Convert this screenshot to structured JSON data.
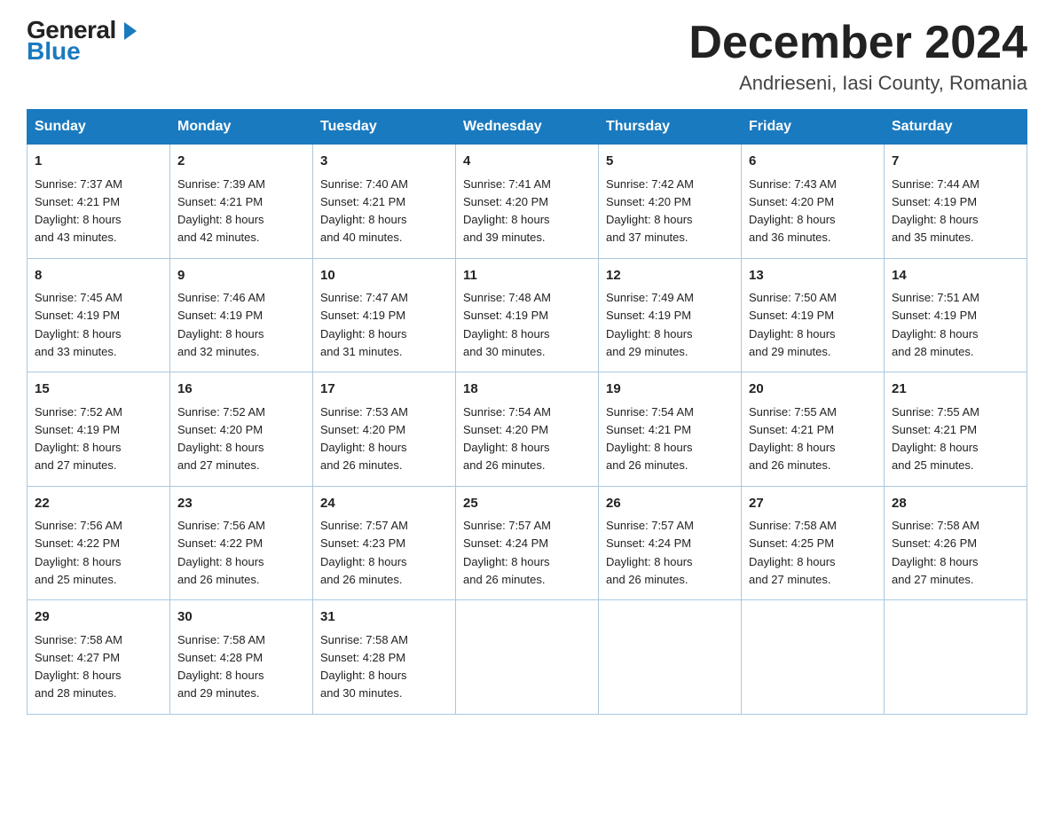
{
  "header": {
    "logo": {
      "general": "General",
      "blue": "Blue"
    },
    "month_title": "December 2024",
    "location": "Andrieseni, Iasi County, Romania"
  },
  "days_of_week": [
    "Sunday",
    "Monday",
    "Tuesday",
    "Wednesday",
    "Thursday",
    "Friday",
    "Saturday"
  ],
  "weeks": [
    [
      {
        "day": "1",
        "sunrise": "7:37 AM",
        "sunset": "4:21 PM",
        "daylight": "8 hours and 43 minutes."
      },
      {
        "day": "2",
        "sunrise": "7:39 AM",
        "sunset": "4:21 PM",
        "daylight": "8 hours and 42 minutes."
      },
      {
        "day": "3",
        "sunrise": "7:40 AM",
        "sunset": "4:21 PM",
        "daylight": "8 hours and 40 minutes."
      },
      {
        "day": "4",
        "sunrise": "7:41 AM",
        "sunset": "4:20 PM",
        "daylight": "8 hours and 39 minutes."
      },
      {
        "day": "5",
        "sunrise": "7:42 AM",
        "sunset": "4:20 PM",
        "daylight": "8 hours and 37 minutes."
      },
      {
        "day": "6",
        "sunrise": "7:43 AM",
        "sunset": "4:20 PM",
        "daylight": "8 hours and 36 minutes."
      },
      {
        "day": "7",
        "sunrise": "7:44 AM",
        "sunset": "4:19 PM",
        "daylight": "8 hours and 35 minutes."
      }
    ],
    [
      {
        "day": "8",
        "sunrise": "7:45 AM",
        "sunset": "4:19 PM",
        "daylight": "8 hours and 33 minutes."
      },
      {
        "day": "9",
        "sunrise": "7:46 AM",
        "sunset": "4:19 PM",
        "daylight": "8 hours and 32 minutes."
      },
      {
        "day": "10",
        "sunrise": "7:47 AM",
        "sunset": "4:19 PM",
        "daylight": "8 hours and 31 minutes."
      },
      {
        "day": "11",
        "sunrise": "7:48 AM",
        "sunset": "4:19 PM",
        "daylight": "8 hours and 30 minutes."
      },
      {
        "day": "12",
        "sunrise": "7:49 AM",
        "sunset": "4:19 PM",
        "daylight": "8 hours and 29 minutes."
      },
      {
        "day": "13",
        "sunrise": "7:50 AM",
        "sunset": "4:19 PM",
        "daylight": "8 hours and 29 minutes."
      },
      {
        "day": "14",
        "sunrise": "7:51 AM",
        "sunset": "4:19 PM",
        "daylight": "8 hours and 28 minutes."
      }
    ],
    [
      {
        "day": "15",
        "sunrise": "7:52 AM",
        "sunset": "4:19 PM",
        "daylight": "8 hours and 27 minutes."
      },
      {
        "day": "16",
        "sunrise": "7:52 AM",
        "sunset": "4:20 PM",
        "daylight": "8 hours and 27 minutes."
      },
      {
        "day": "17",
        "sunrise": "7:53 AM",
        "sunset": "4:20 PM",
        "daylight": "8 hours and 26 minutes."
      },
      {
        "day": "18",
        "sunrise": "7:54 AM",
        "sunset": "4:20 PM",
        "daylight": "8 hours and 26 minutes."
      },
      {
        "day": "19",
        "sunrise": "7:54 AM",
        "sunset": "4:21 PM",
        "daylight": "8 hours and 26 minutes."
      },
      {
        "day": "20",
        "sunrise": "7:55 AM",
        "sunset": "4:21 PM",
        "daylight": "8 hours and 26 minutes."
      },
      {
        "day": "21",
        "sunrise": "7:55 AM",
        "sunset": "4:21 PM",
        "daylight": "8 hours and 25 minutes."
      }
    ],
    [
      {
        "day": "22",
        "sunrise": "7:56 AM",
        "sunset": "4:22 PM",
        "daylight": "8 hours and 25 minutes."
      },
      {
        "day": "23",
        "sunrise": "7:56 AM",
        "sunset": "4:22 PM",
        "daylight": "8 hours and 26 minutes."
      },
      {
        "day": "24",
        "sunrise": "7:57 AM",
        "sunset": "4:23 PM",
        "daylight": "8 hours and 26 minutes."
      },
      {
        "day": "25",
        "sunrise": "7:57 AM",
        "sunset": "4:24 PM",
        "daylight": "8 hours and 26 minutes."
      },
      {
        "day": "26",
        "sunrise": "7:57 AM",
        "sunset": "4:24 PM",
        "daylight": "8 hours and 26 minutes."
      },
      {
        "day": "27",
        "sunrise": "7:58 AM",
        "sunset": "4:25 PM",
        "daylight": "8 hours and 27 minutes."
      },
      {
        "day": "28",
        "sunrise": "7:58 AM",
        "sunset": "4:26 PM",
        "daylight": "8 hours and 27 minutes."
      }
    ],
    [
      {
        "day": "29",
        "sunrise": "7:58 AM",
        "sunset": "4:27 PM",
        "daylight": "8 hours and 28 minutes."
      },
      {
        "day": "30",
        "sunrise": "7:58 AM",
        "sunset": "4:28 PM",
        "daylight": "8 hours and 29 minutes."
      },
      {
        "day": "31",
        "sunrise": "7:58 AM",
        "sunset": "4:28 PM",
        "daylight": "8 hours and 30 minutes."
      },
      null,
      null,
      null,
      null
    ]
  ],
  "labels": {
    "sunrise": "Sunrise:",
    "sunset": "Sunset:",
    "daylight": "Daylight:"
  },
  "colors": {
    "header_bg": "#1a7abf",
    "header_text": "#ffffff",
    "border": "#aac8e0"
  }
}
